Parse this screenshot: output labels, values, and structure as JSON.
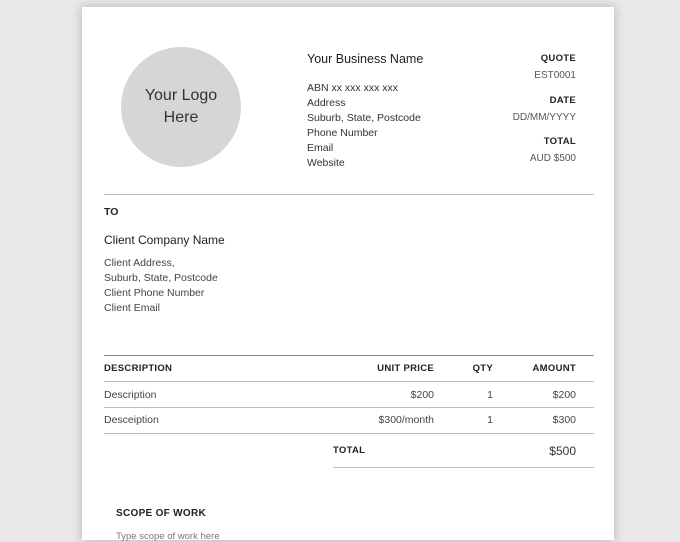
{
  "logo": {
    "placeholder_text": "Your Logo Here"
  },
  "business": {
    "name": "Your Business Name",
    "lines": [
      "ABN xx xxx xxx xxx",
      "Address",
      "Suburb, State, Postcode",
      "Phone Number",
      "Email",
      "Website"
    ]
  },
  "meta": {
    "quote_label": "QUOTE",
    "quote_number": "EST0001",
    "date_label": "DATE",
    "date_value": "DD/MM/YYYY",
    "total_label": "TOTAL",
    "total_value": "AUD $500"
  },
  "recipient": {
    "label": "TO",
    "company": "Client Company Name",
    "lines": [
      "Client Address,",
      "Suburb, State, Postcode",
      "Client Phone Number",
      "Client Email"
    ]
  },
  "table": {
    "headers": {
      "description": "DESCRIPTION",
      "unit_price": "UNIT PRICE",
      "qty": "QTY",
      "amount": "AMOUNT"
    },
    "rows": [
      {
        "description": "Description",
        "unit_price": "$200",
        "qty": "1",
        "amount": "$200"
      },
      {
        "description": "Desceiption",
        "unit_price": "$300/month",
        "qty": "1",
        "amount": "$300"
      }
    ],
    "total_label": "TOTAL",
    "total_value": "$500"
  },
  "scope": {
    "label": "SCOPE OF WORK",
    "text": "Type scope of work here"
  }
}
